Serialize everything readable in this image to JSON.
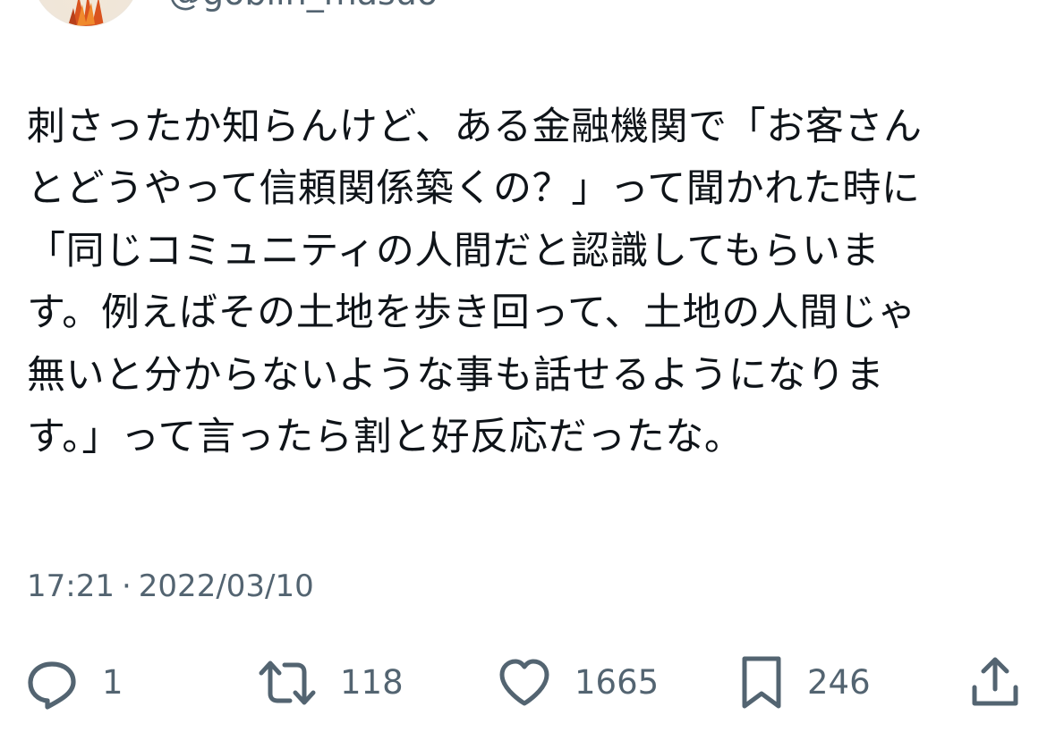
{
  "author": {
    "handle": "@goblin_masuo"
  },
  "tweet": {
    "text": "刺さったか知らんけど、ある金融機関で「お客さん\nとどうやって信頼関係築くの？」って聞かれた時に\n「同じコミュニティの人間だと認識してもらいま\nす。例えばその土地を歩き回って、土地の人間じゃ\n無いと分からないような事も話せるようになりま\nす。」って言ったら割と好反応だったな。",
    "time": "17:21",
    "separator": "·",
    "date": "2022/03/10"
  },
  "actions": {
    "reply": {
      "icon": "reply-icon",
      "count": "1"
    },
    "retweet": {
      "icon": "retweet-icon",
      "count": "118"
    },
    "like": {
      "icon": "heart-icon",
      "count": "1665"
    },
    "bookmark": {
      "icon": "bookmark-icon",
      "count": "246"
    },
    "share": {
      "icon": "share-icon"
    }
  },
  "colors": {
    "text": "#0f1419",
    "secondary": "#536471",
    "background": "#ffffff"
  }
}
